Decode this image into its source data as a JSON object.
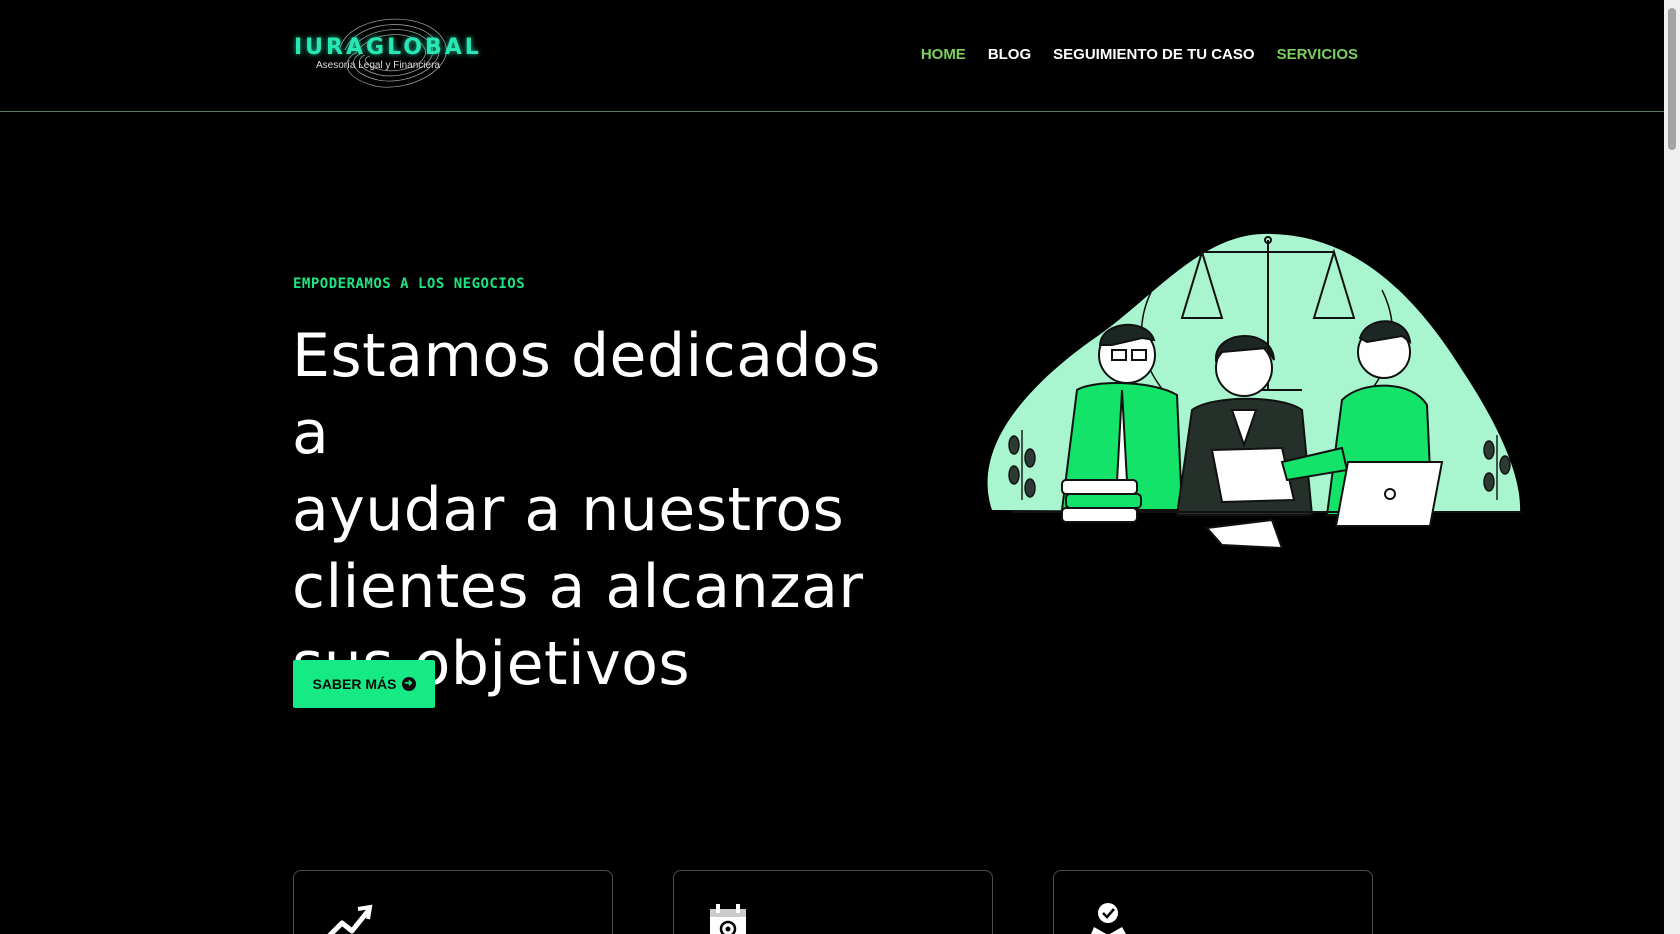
{
  "brand": {
    "name": "IURAGLOBAL",
    "tagline": "Asesoría Legal y Financiera",
    "accent": "#15ea84"
  },
  "nav": {
    "items": [
      {
        "label": "HOME",
        "color": "#7bd05e"
      },
      {
        "label": "BLOG",
        "color": "#ffffff"
      },
      {
        "label": "SEGUIMIENTO DE TU CASO",
        "color": "#ffffff"
      },
      {
        "label": "SERVICIOS",
        "color": "#7bd05e"
      }
    ]
  },
  "hero": {
    "eyebrow": "EMPODERAMOS A LOS NEGOCIOS",
    "headline_lines": [
      "Estamos dedicados a",
      "ayudar a nuestros",
      "clientes a alcanzar",
      "sus objetivos"
    ],
    "cta_label": "SABER MÁS",
    "cta_icon": "arrow-circle-right-icon"
  },
  "cards": [
    {
      "icon": "growth-chart-icon"
    },
    {
      "icon": "calendar-gear-icon"
    },
    {
      "icon": "handshake-check-icon"
    }
  ]
}
